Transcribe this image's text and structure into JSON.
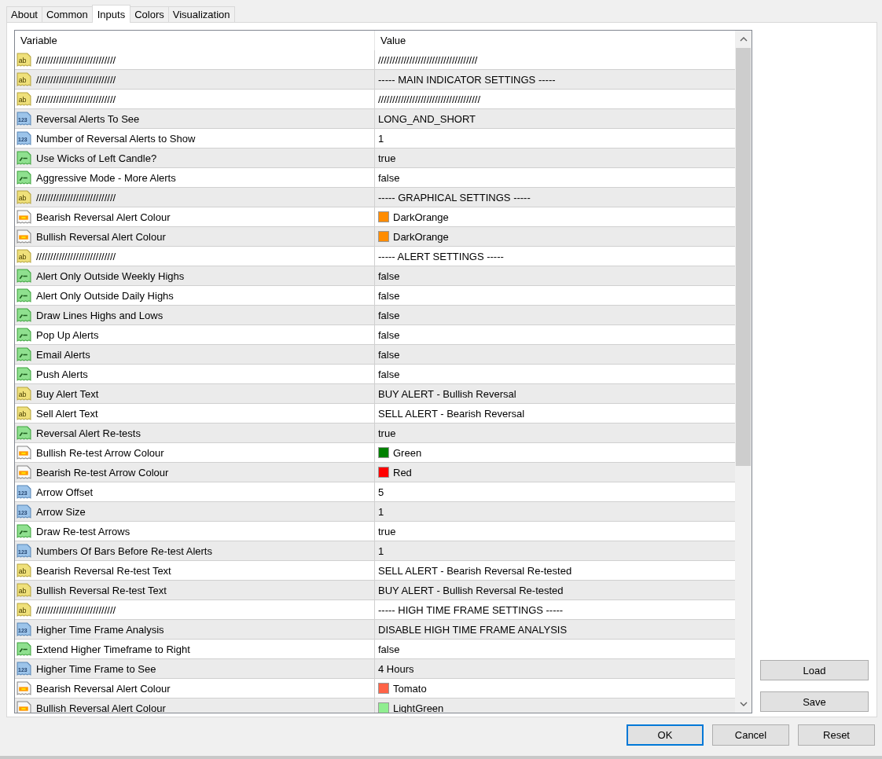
{
  "tabs": [
    {
      "label": "About",
      "selected": false
    },
    {
      "label": "Common",
      "selected": false
    },
    {
      "label": "Inputs",
      "selected": true
    },
    {
      "label": "Colors",
      "selected": false
    },
    {
      "label": "Visualization",
      "selected": false
    }
  ],
  "table": {
    "columns": [
      "Variable",
      "Value"
    ],
    "rows": [
      {
        "kind": "string",
        "icon_text": "ab",
        "variable": "////////////////////////////",
        "value": "///////////////////////////////////"
      },
      {
        "kind": "string",
        "icon_text": "ab",
        "variable": "////////////////////////////",
        "value": "----- MAIN INDICATOR SETTINGS -----"
      },
      {
        "kind": "string",
        "icon_text": "ab",
        "variable": "////////////////////////////",
        "value": "////////////////////////////////////"
      },
      {
        "kind": "int",
        "icon_text": "123",
        "variable": "Reversal Alerts To See",
        "value": "LONG_AND_SHORT"
      },
      {
        "kind": "int",
        "icon_text": "123",
        "variable": "Number of Reversal Alerts to Show",
        "value": "1"
      },
      {
        "kind": "bool",
        "variable": "Use Wicks of Left Candle?",
        "value": "true"
      },
      {
        "kind": "bool",
        "variable": "Aggressive Mode - More Alerts",
        "value": "false"
      },
      {
        "kind": "string",
        "icon_text": "ab",
        "variable": "////////////////////////////",
        "value": "----- GRAPHICAL SETTINGS -----"
      },
      {
        "kind": "color",
        "variable": "Bearish Reversal Alert Colour",
        "value": "DarkOrange",
        "color": "#ff8c00"
      },
      {
        "kind": "color",
        "variable": "Bullish Reversal Alert Colour",
        "value": "DarkOrange",
        "color": "#ff8c00"
      },
      {
        "kind": "string",
        "icon_text": "ab",
        "variable": "////////////////////////////",
        "value": "----- ALERT SETTINGS -----"
      },
      {
        "kind": "bool",
        "variable": "Alert Only Outside Weekly Highs",
        "value": "false"
      },
      {
        "kind": "bool",
        "variable": "Alert Only Outside Daily Highs",
        "value": "false"
      },
      {
        "kind": "bool",
        "variable": "Draw Lines Highs and Lows",
        "value": "false"
      },
      {
        "kind": "bool",
        "variable": "Pop Up Alerts",
        "value": "false"
      },
      {
        "kind": "bool",
        "variable": "Email Alerts",
        "value": "false"
      },
      {
        "kind": "bool",
        "variable": "Push Alerts",
        "value": "false"
      },
      {
        "kind": "string",
        "icon_text": "ab",
        "variable": "Buy Alert Text",
        "value": "BUY ALERT - Bullish Reversal"
      },
      {
        "kind": "string",
        "icon_text": "ab",
        "variable": "Sell Alert Text",
        "value": "SELL ALERT - Bearish Reversal"
      },
      {
        "kind": "bool",
        "variable": "Reversal Alert Re-tests",
        "value": "true"
      },
      {
        "kind": "color",
        "variable": "Bullish Re-test Arrow Colour",
        "value": "Green",
        "color": "#008000"
      },
      {
        "kind": "color",
        "variable": "Bearish Re-test Arrow Colour",
        "value": "Red",
        "color": "#ff0000"
      },
      {
        "kind": "int",
        "icon_text": "123",
        "variable": "Arrow Offset",
        "value": "5"
      },
      {
        "kind": "int",
        "icon_text": "123",
        "variable": "Arrow Size",
        "value": "1"
      },
      {
        "kind": "bool",
        "variable": "Draw Re-test Arrows",
        "value": "true"
      },
      {
        "kind": "int",
        "icon_text": "123",
        "variable": "Numbers Of Bars Before Re-test Alerts",
        "value": "1"
      },
      {
        "kind": "string",
        "icon_text": "ab",
        "variable": "Bearish Reversal Re-test Text",
        "value": "SELL ALERT - Bearish Reversal Re-tested"
      },
      {
        "kind": "string",
        "icon_text": "ab",
        "variable": "Bullish Reversal Re-test Text",
        "value": "BUY ALERT - Bullish Reversal Re-tested"
      },
      {
        "kind": "string",
        "icon_text": "ab",
        "variable": "////////////////////////////",
        "value": "----- HIGH TIME FRAME SETTINGS -----"
      },
      {
        "kind": "int",
        "icon_text": "123",
        "variable": "Higher Time Frame Analysis",
        "value": "DISABLE HIGH TIME FRAME ANALYSIS"
      },
      {
        "kind": "bool",
        "variable": "Extend Higher Timeframe to Right",
        "value": "false"
      },
      {
        "kind": "int",
        "icon_text": "123",
        "variable": "Higher Time Frame to See",
        "value": "4 Hours"
      },
      {
        "kind": "color",
        "variable": "Bearish Reversal Alert Colour",
        "value": "Tomato",
        "color": "#ff6347"
      },
      {
        "kind": "color",
        "variable": "Bullish Reversal Alert Colour",
        "value": "LightGreen",
        "color": "#90ee90"
      }
    ]
  },
  "side_buttons": [
    "Load",
    "Save"
  ],
  "footer_buttons": [
    {
      "label": "OK",
      "default": true
    },
    {
      "label": "Cancel",
      "default": false
    },
    {
      "label": "Reset",
      "default": false
    }
  ]
}
